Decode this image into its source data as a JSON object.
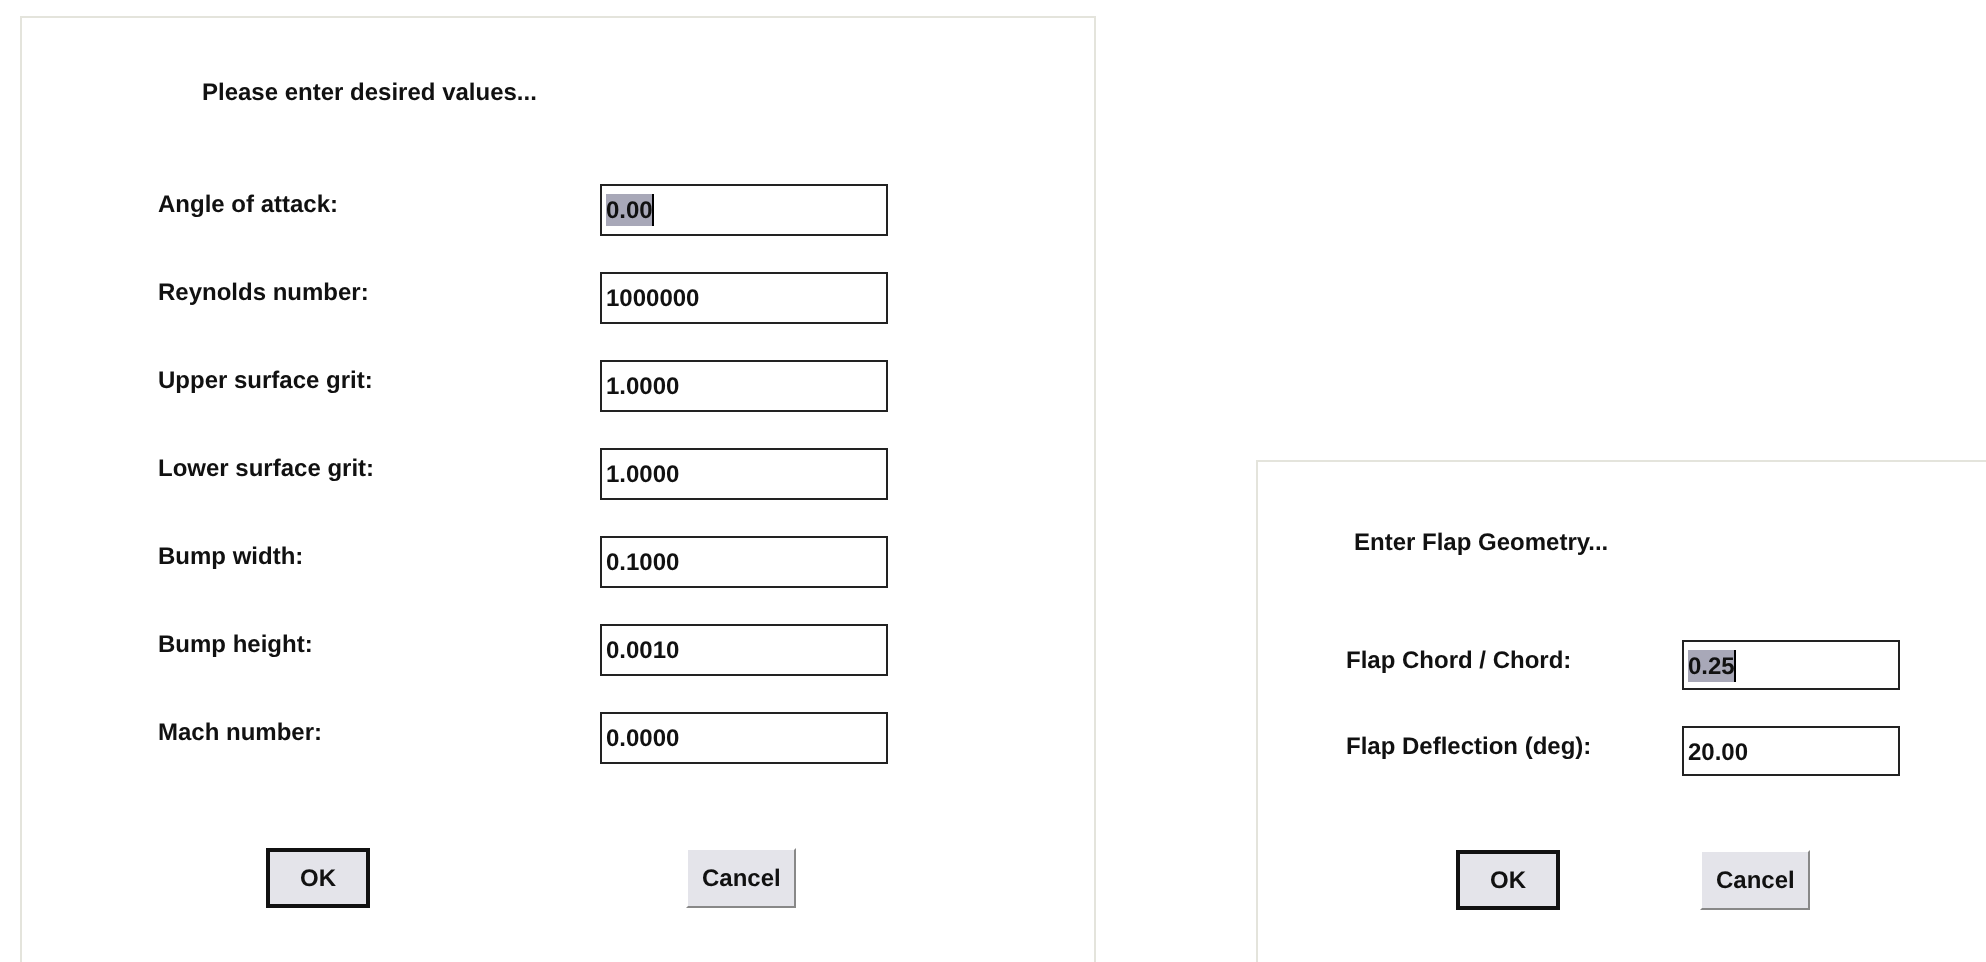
{
  "dialogs": [
    {
      "prompt": "Please enter desired values...",
      "fields": [
        {
          "label": "Angle of attack:",
          "value": "0.00",
          "selected": true
        },
        {
          "label": "Reynolds number:",
          "value": "1000000",
          "selected": false
        },
        {
          "label": "Upper surface grit:",
          "value": "1.0000",
          "selected": false
        },
        {
          "label": "Lower surface grit:",
          "value": "1.0000",
          "selected": false
        },
        {
          "label": "Bump width:",
          "value": "0.1000",
          "selected": false
        },
        {
          "label": "Bump height:",
          "value": "0.0010",
          "selected": false
        },
        {
          "label": "Mach number:",
          "value": "0.0000",
          "selected": false
        }
      ],
      "buttons": [
        {
          "label": "OK",
          "default": true
        },
        {
          "label": "Cancel",
          "default": false
        }
      ]
    },
    {
      "prompt": "Enter Flap Geometry...",
      "fields": [
        {
          "label": "Flap Chord / Chord:",
          "value": "0.25",
          "selected": true
        },
        {
          "label": "Flap Deflection (deg):",
          "value": "20.00",
          "selected": false
        }
      ],
      "buttons": [
        {
          "label": "OK",
          "default": true
        },
        {
          "label": "Cancel",
          "default": false
        }
      ]
    }
  ]
}
